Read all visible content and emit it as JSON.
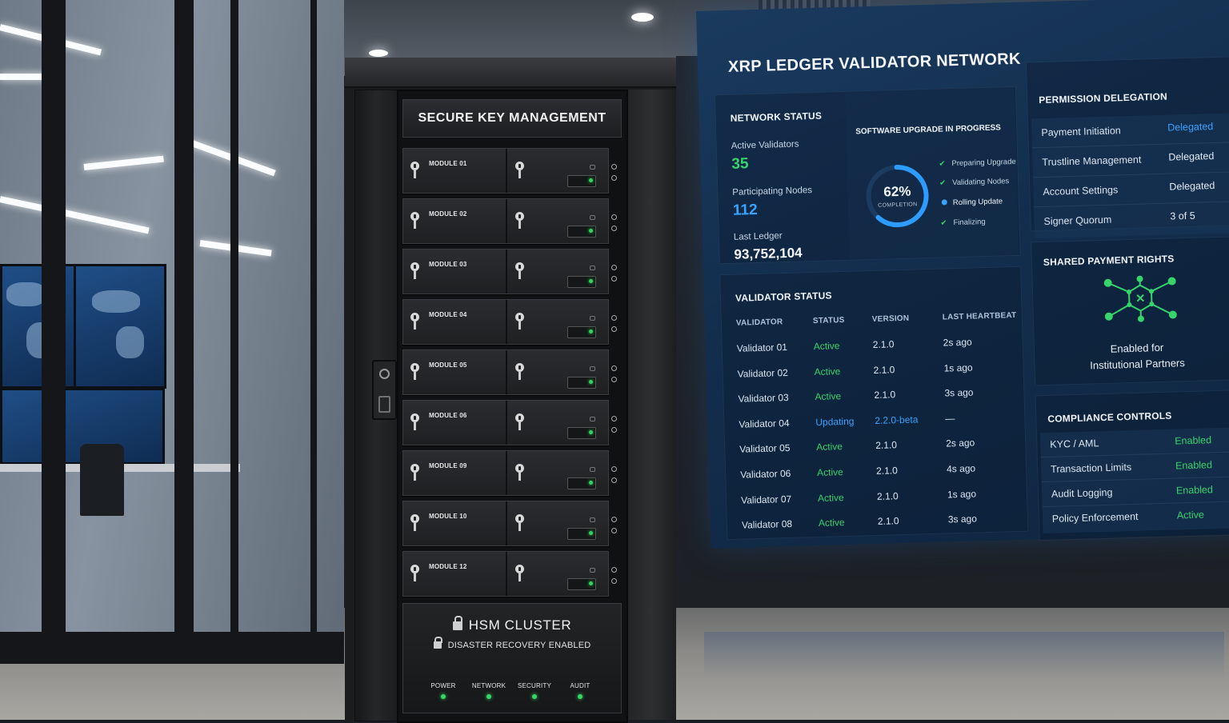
{
  "cabinet": {
    "header": "SECURE KEY MANAGEMENT",
    "modules": [
      "MODULE 01",
      "MODULE 02",
      "MODULE 03",
      "MODULE 04",
      "MODULE 05",
      "MODULE 06",
      "MODULE 09",
      "MODULE 10",
      "MODULE 12"
    ],
    "footer": {
      "title": "HSM CLUSTER",
      "subtitle": "DISASTER RECOVERY ENABLED",
      "indicators": [
        "POWER",
        "NETWORK",
        "SECURITY",
        "AUDIT"
      ],
      "indicator_color": "#35d765"
    }
  },
  "display": {
    "title": "XRP LEDGER VALIDATOR NETWORK",
    "network_status": {
      "heading": "NETWORK STATUS",
      "active_validators_label": "Active Validators",
      "active_validators": "35",
      "participating_nodes_label": "Participating Nodes",
      "participating_nodes": "112",
      "last_ledger_label": "Last Ledger",
      "last_ledger": "93,752,104"
    },
    "upgrade": {
      "heading": "SOFTWARE UPGRADE IN PROGRESS",
      "percent_text": "62%",
      "progress": 0.62,
      "completion_label": "COMPLETION",
      "steps": [
        {
          "label": "Preparing Upgrade",
          "state": "done"
        },
        {
          "label": "Validating Nodes",
          "state": "done"
        },
        {
          "label": "Rolling Update",
          "state": "active"
        },
        {
          "label": "Finalizing",
          "state": "done"
        }
      ]
    },
    "validator_status": {
      "heading": "VALIDATOR STATUS",
      "columns": [
        "VALIDATOR",
        "STATUS",
        "VERSION",
        "LAST HEARTBEAT"
      ],
      "rows": [
        {
          "validator": "Validator 01",
          "status": "Active",
          "version": "2.1.0",
          "heartbeat": "2s ago"
        },
        {
          "validator": "Validator 02",
          "status": "Active",
          "version": "2.1.0",
          "heartbeat": "1s ago"
        },
        {
          "validator": "Validator 03",
          "status": "Active",
          "version": "2.1.0",
          "heartbeat": "3s ago"
        },
        {
          "validator": "Validator 04",
          "status": "Updating",
          "version": "2.2.0-beta",
          "heartbeat": "—"
        },
        {
          "validator": "Validator 05",
          "status": "Active",
          "version": "2.1.0",
          "heartbeat": "2s ago"
        },
        {
          "validator": "Validator 06",
          "status": "Active",
          "version": "2.1.0",
          "heartbeat": "4s ago"
        },
        {
          "validator": "Validator 07",
          "status": "Active",
          "version": "2.1.0",
          "heartbeat": "1s ago"
        },
        {
          "validator": "Validator 08",
          "status": "Active",
          "version": "2.1.0",
          "heartbeat": "3s ago"
        }
      ]
    },
    "permission_delegation": {
      "heading": "PERMISSION DELEGATION",
      "rows": [
        {
          "name": "Payment Initiation",
          "value": "Delegated"
        },
        {
          "name": "Trustline Management",
          "value": "Delegated"
        },
        {
          "name": "Account Settings",
          "value": "Delegated"
        },
        {
          "name": "Signer Quorum",
          "value": "3 of 5"
        }
      ]
    },
    "shared_payment_rights": {
      "heading": "SHARED PAYMENT RIGHTS",
      "line1": "Enabled for",
      "line2": "Institutional Partners",
      "icon": "network-hub-icon",
      "icon_color": "#37d36b"
    },
    "compliance_controls": {
      "heading": "COMPLIANCE CONTROLS",
      "rows": [
        {
          "name": "KYC / AML",
          "value": "Enabled"
        },
        {
          "name": "Transaction Limits",
          "value": "Enabled"
        },
        {
          "name": "Audit Logging",
          "value": "Enabled"
        },
        {
          "name": "Policy Enforcement",
          "value": "Active"
        }
      ]
    },
    "colors": {
      "active": "#37d36b",
      "updating": "#3aa2ff",
      "accent": "#3aa2ff"
    }
  }
}
